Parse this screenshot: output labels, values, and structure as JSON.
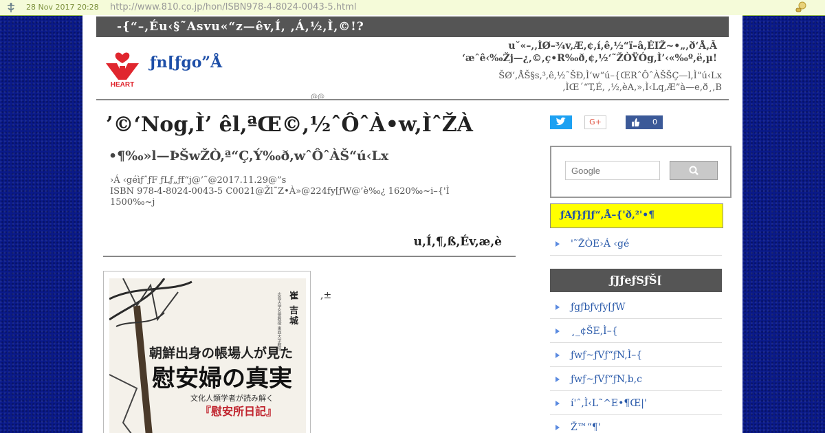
{
  "wayback": {
    "date": "28 Nov 2017 20:28",
    "url": "http://www.810.co.jp/hon/ISBN978-4-8024-0043-5.html"
  },
  "header": {
    "topbar": "-{“–,Éu‹§˜Asvu«“z—êv,Í, ,Á,½,Ì,©!?",
    "logo_text": "HEART",
    "site_name": "ƒn[ƒgo”Å",
    "tagline_1": "u˘«–,,ÌØ–¾v,Æ,¢,í,ê,½“ï–â,ÉIŽ~•„,ð‘Å,Â",
    "tagline_2": "‘æˆê‹‰Žj—¿,©,ç•R‰ð,¢,½‘˜ŽÒŸÓg,Ì’‹«‰º,ë,µ!",
    "desc_1": "ŠØ‘,ÅŠ§s,³,ê,½˜ŠÐ,Ì‘w“ú–{ŒRˆÔˆÀŠŠÇ—l,Ì“ú‹Lx",
    "desc_2": ",ÌŒ´“T,É, ,½,èA,»,Ì‹Lq,Æ”à—e,ð¸,B",
    "mark": "@@"
  },
  "article": {
    "title": "’©‘Nog,Ì’ êl,ªŒ©,½ˆÔˆÀ•w,ÌˆŽÀ",
    "subtitle": "•¶‰»l—ÞŠwŽÒ,ª“Ç,Ý‰ð,wˆÔˆÀŠ“ú‹Lx",
    "meta_line1": "›Á ‹géìƒˆƒF ƒLƒ„ƒf“j@’˜@2017.11.29@”s",
    "meta_line2": "ISBN 978-4-8024-0043-5 C0021@Žl˜Z•À»@224fy[ƒW@’è‰¿ 1620‰~i–{'Ì",
    "meta_line3": "1500‰~j",
    "content_heading": "u,Í,¶,ß,Év,æ,è",
    "side_text": ",±"
  },
  "book_cover": {
    "author": "崔 吉城",
    "affiliation": "広島大学名誉教授 東亜大学教授",
    "title_line1": "朝鮮出身の帳場人が見た",
    "title_line2": "慰安婦の真実",
    "subtitle": "文化人類学者が読み解く",
    "subtitle2": "『慰安所日記』"
  },
  "social": {
    "gplus_label": "G+",
    "like_count": "0"
  },
  "search": {
    "placeholder": "Google"
  },
  "sidebar": {
    "yellow_box": "ƒAƒ}ƒ]ƒ“,Å–{'ð,²'•¶",
    "link_top": "'˜ŽÒE›Á ‹gé",
    "category_heading": "ƒJƒeƒSƒŠ[",
    "links": [
      "ƒgƒbƒvƒy[ƒW",
      "¸_¢ŠE,Ì–{",
      "ƒwƒ~ƒVƒ“ƒN,Ì–{",
      "ƒwƒ~ƒVƒ“ƒN,b,c",
      "í'ˆ,Ì‹L˜^E•¶Œ|'",
      "Ž™“¶'"
    ]
  },
  "colors": {
    "background": "#0a1a8a",
    "topbar": "#555555",
    "link": "#2a5aaa",
    "accent_yellow": "#ffff00",
    "logo_red": "#e0262e"
  }
}
